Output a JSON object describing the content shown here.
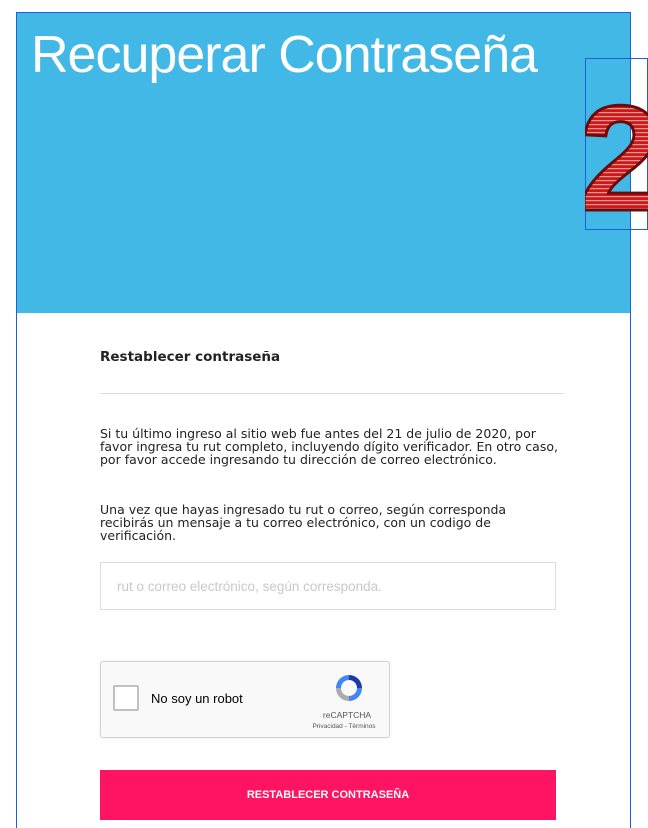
{
  "hero": {
    "title": "Recuperar Contraseña",
    "background": "#41b8e6",
    "step_number": "2"
  },
  "form": {
    "section_title": "Restablecer contraseña",
    "paragraph_1": "Si tu último ingreso al sitio web fue antes del 21 de julio de 2020, por favor ingresa tu rut completo, incluyendo dígito verificador. En otro caso, por favor accede ingresando tu dirección de correo electrónico.",
    "paragraph_2": "Una vez que hayas ingresado tu rut o correo, según corresponda recibirás un mensaje a tu correo electrónico, con un codigo de verificación.",
    "input": {
      "value": "",
      "placeholder": "rut o correo electrónico, según corresponda."
    },
    "captcha": {
      "checkbox_label": "No soy un robot",
      "brand": "reCAPTCHA",
      "links": "Privacidad - Términos",
      "icon": "recaptcha-icon"
    },
    "submit_label": "RESTABLECER CONTRASEÑA",
    "submit_color": "#ff1463"
  }
}
